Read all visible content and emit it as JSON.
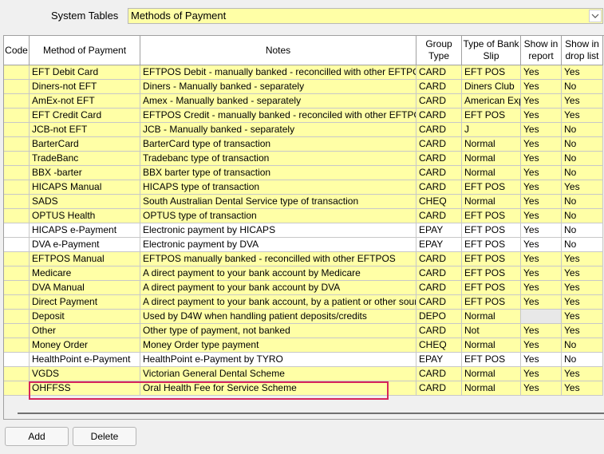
{
  "system_tables": {
    "label": "System Tables",
    "selected": "Methods of Payment",
    "dropdown_icon": "chevron-down-icon"
  },
  "grid": {
    "columns": [
      "Code",
      "Method of Payment",
      "Notes",
      "Group Type",
      "Type of Bank Slip",
      "Show in report",
      "Show in drop list"
    ],
    "rows": [
      {
        "code": "",
        "method": "EFT Debit Card",
        "notes": "EFTPOS Debit - manually banked - reconcilled with other EFTPOS",
        "group": "CARD",
        "bank_slip": "EFT POS",
        "report": "Yes",
        "drop": "Yes",
        "bg": "yellow"
      },
      {
        "code": "",
        "method": "Diners-not EFT",
        "notes": "Diners - Manually banked - separately",
        "group": "CARD",
        "bank_slip": "Diners Club",
        "report": "Yes",
        "drop": "No",
        "bg": "yellow"
      },
      {
        "code": "",
        "method": "AmEx-not EFT",
        "notes": "Amex - Manually banked - separately",
        "group": "CARD",
        "bank_slip": "American Express",
        "report": "Yes",
        "drop": "Yes",
        "bg": "yellow"
      },
      {
        "code": "",
        "method": "EFT Credit Card",
        "notes": "EFTPOS Credit - manually banked - reconciled with other EFTPOS",
        "group": "CARD",
        "bank_slip": "EFT POS",
        "report": "Yes",
        "drop": "Yes",
        "bg": "yellow"
      },
      {
        "code": "",
        "method": "JCB-not EFT",
        "notes": "JCB - Manually banked - separately",
        "group": "CARD",
        "bank_slip": "J",
        "report": "Yes",
        "drop": "No",
        "bg": "yellow"
      },
      {
        "code": "",
        "method": "BarterCard",
        "notes": "BarterCard type of transaction",
        "group": "CARD",
        "bank_slip": "Normal",
        "report": "Yes",
        "drop": "No",
        "bg": "yellow"
      },
      {
        "code": "",
        "method": "TradeBanc",
        "notes": "Tradebanc type of transaction",
        "group": "CARD",
        "bank_slip": "Normal",
        "report": "Yes",
        "drop": "No",
        "bg": "yellow"
      },
      {
        "code": "",
        "method": "BBX -barter",
        "notes": "BBX barter type of transaction",
        "group": "CARD",
        "bank_slip": "Normal",
        "report": "Yes",
        "drop": "No",
        "bg": "yellow"
      },
      {
        "code": "",
        "method": "HICAPS Manual",
        "notes": "HICAPS type of transaction",
        "group": "CARD",
        "bank_slip": "EFT POS",
        "report": "Yes",
        "drop": "Yes",
        "bg": "yellow"
      },
      {
        "code": "",
        "method": "SADS",
        "notes": "South Australian Dental Service type of transaction",
        "group": "CHEQ",
        "bank_slip": "Normal",
        "report": "Yes",
        "drop": "No",
        "bg": "yellow"
      },
      {
        "code": "",
        "method": "OPTUS Health",
        "notes": "OPTUS type of transaction",
        "group": "CARD",
        "bank_slip": "EFT POS",
        "report": "Yes",
        "drop": "No",
        "bg": "yellow"
      },
      {
        "code": "",
        "method": "HICAPS e-Payment",
        "notes": "Electronic payment by HICAPS",
        "group": "EPAY",
        "bank_slip": "EFT POS",
        "report": "Yes",
        "drop": "No",
        "bg": "white"
      },
      {
        "code": "",
        "method": "DVA e-Payment",
        "notes": "Electronic payment by DVA",
        "group": "EPAY",
        "bank_slip": "EFT POS",
        "report": "Yes",
        "drop": "No",
        "bg": "white"
      },
      {
        "code": "",
        "method": "EFTPOS Manual",
        "notes": "EFTPOS manually banked - reconcilled with other EFTPOS",
        "group": "CARD",
        "bank_slip": "EFT POS",
        "report": "Yes",
        "drop": "Yes",
        "bg": "yellow"
      },
      {
        "code": "",
        "method": "Medicare",
        "notes": "A direct payment to your bank account by Medicare",
        "group": "CARD",
        "bank_slip": "EFT POS",
        "report": "Yes",
        "drop": "Yes",
        "bg": "yellow"
      },
      {
        "code": "",
        "method": "DVA Manual",
        "notes": "A direct payment to your bank account by DVA",
        "group": "CARD",
        "bank_slip": "EFT POS",
        "report": "Yes",
        "drop": "Yes",
        "bg": "yellow"
      },
      {
        "code": "",
        "method": "Direct Payment",
        "notes": "A direct payment to your bank account, by a patient or other source",
        "group": "CARD",
        "bank_slip": "EFT POS",
        "report": "Yes",
        "drop": "Yes",
        "bg": "yellow"
      },
      {
        "code": "",
        "method": "Deposit",
        "notes": "Used by D4W when handling patient deposits/credits",
        "group": "DEPO",
        "bank_slip": "Normal",
        "report": "",
        "drop": "Yes",
        "bg": "yellow",
        "report_grey": true
      },
      {
        "code": "",
        "method": "Other",
        "notes": "Other type of payment, not banked",
        "group": "CARD",
        "bank_slip": "Not",
        "report": "Yes",
        "drop": "Yes",
        "bg": "yellow"
      },
      {
        "code": "",
        "method": "Money Order",
        "notes": "Money Order type payment",
        "group": "CHEQ",
        "bank_slip": "Normal",
        "report": "Yes",
        "drop": "No",
        "bg": "yellow"
      },
      {
        "code": "",
        "method": "HealthPoint e-Payment",
        "notes": "HealthPoint e-Payment by TYRO",
        "group": "EPAY",
        "bank_slip": "EFT POS",
        "report": "Yes",
        "drop": "No",
        "bg": "white"
      },
      {
        "code": "",
        "method": "VGDS",
        "notes": "Victorian General Dental Scheme",
        "group": "CARD",
        "bank_slip": "Normal",
        "report": "Yes",
        "drop": "Yes",
        "bg": "yellow"
      },
      {
        "code": "",
        "method": "OHFFSS",
        "notes": "Oral Health Fee for Service Scheme",
        "group": "CARD",
        "bank_slip": "Normal",
        "report": "Yes",
        "drop": "Yes",
        "bg": "yellow"
      }
    ]
  },
  "buttons": {
    "add": "Add",
    "delete": "Delete"
  }
}
